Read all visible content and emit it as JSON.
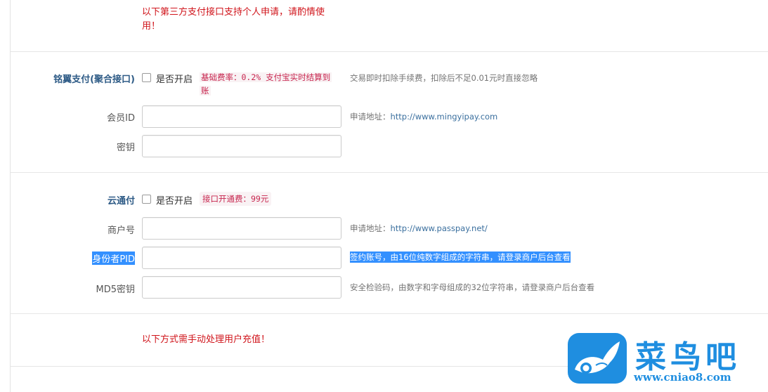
{
  "notices": {
    "top_line1": "以下第三方支付接口支持个人申请，请酌情使",
    "top_line2": "用！",
    "bottom": "以下方式需手动处理用户充值！"
  },
  "mingyi": {
    "title": "铭翼支付(聚合接口)",
    "enable_label": "是否开启",
    "enabled": false,
    "rate_line1": "基础费率：0.2% 支付宝实时结算到",
    "rate_line2": "账",
    "fee_note": "交易即时扣除手续费，扣除后不足0.01元时直接忽略",
    "member_id_label": "会员ID",
    "member_id_value": "",
    "apply_prefix": "申请地址：",
    "apply_url": "http://www.mingyipay.com",
    "secret_label": "密钥",
    "secret_value": ""
  },
  "yuntong": {
    "title": "云通付",
    "enable_label": "是否开启",
    "enabled": false,
    "fee_badge": "接口开通费：99元",
    "merchant_label": "商户号",
    "merchant_value": "",
    "apply_prefix": "申请地址：",
    "apply_url": "http://www.passpay.net/",
    "pid_label": "身份者PID",
    "pid_value": "",
    "pid_help": "签约账号，由16位纯数字组成的字符串，请登录商户后台查看",
    "md5_label": "MD5密钥",
    "md5_value": "",
    "md5_help": "安全检验码，由数字和字母组成的32位字符串，请登录商户后台查看"
  },
  "watermark": {
    "name": "菜鸟吧",
    "url": "www.cniao8.com",
    "brand_color": "#1f8ee0"
  },
  "colors": {
    "notice": "#d0141b",
    "section_title": "#2e5b86",
    "code": "#c7254e",
    "selection": "#3390ff"
  }
}
